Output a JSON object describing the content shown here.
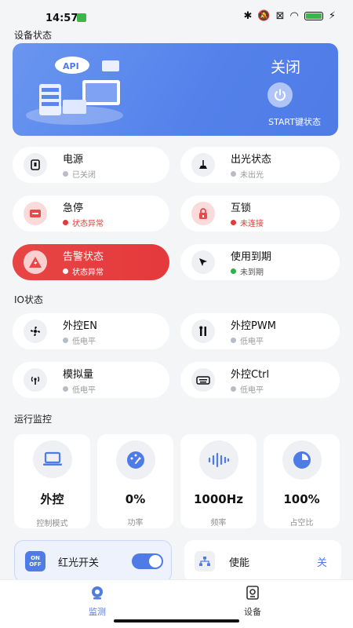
{
  "status_bar": {
    "time": "14:57"
  },
  "sections": {
    "device_status": "设备状态",
    "io_status": "IO状态",
    "run_monitor": "运行监控"
  },
  "banner": {
    "state": "关闭",
    "start_label": "START键状态",
    "illus_text": "API"
  },
  "device_cards": [
    {
      "title": "电源",
      "status": "已关闭",
      "icon": "power-plug-icon"
    },
    {
      "title": "出光状态",
      "status": "未出光",
      "icon": "lamp-icon"
    },
    {
      "title": "急停",
      "status": "状态异常",
      "icon": "emergency-stop-icon"
    },
    {
      "title": "互锁",
      "status": "未连接",
      "icon": "lock-icon"
    },
    {
      "title": "告警状态",
      "status": "状态异常",
      "icon": "alarm-icon"
    },
    {
      "title": "使用到期",
      "status": "未到期",
      "icon": "cursor-icon"
    }
  ],
  "io_cards": [
    {
      "title": "外控EN",
      "status": "低电平",
      "icon": "fan-icon"
    },
    {
      "title": "外控PWM",
      "status": "低电平",
      "icon": "tools-icon"
    },
    {
      "title": "模拟量",
      "status": "低电平",
      "icon": "antenna-icon"
    },
    {
      "title": "外控Ctrl",
      "status": "低电平",
      "icon": "keyboard-icon"
    }
  ],
  "monitor": [
    {
      "value": "外控",
      "label": "控制模式",
      "icon": "laptop-icon"
    },
    {
      "value": "0%",
      "label": "功率",
      "icon": "gauge-icon"
    },
    {
      "value": "1000Hz",
      "label": "频率",
      "icon": "waveform-icon"
    },
    {
      "value": "100%",
      "label": "占空比",
      "icon": "pie-chart-icon"
    }
  ],
  "bottom": {
    "red_light": {
      "label": "红光开关",
      "icon_text": "ON OFF",
      "on": true
    },
    "enable": {
      "label": "使能",
      "value": "关"
    }
  },
  "tabs": [
    {
      "label": "监测",
      "active": true
    },
    {
      "label": "设备",
      "active": false
    }
  ],
  "colors": {
    "accent": "#4f7be6",
    "alert": "#e5393c",
    "ok": "#2bb24c"
  }
}
